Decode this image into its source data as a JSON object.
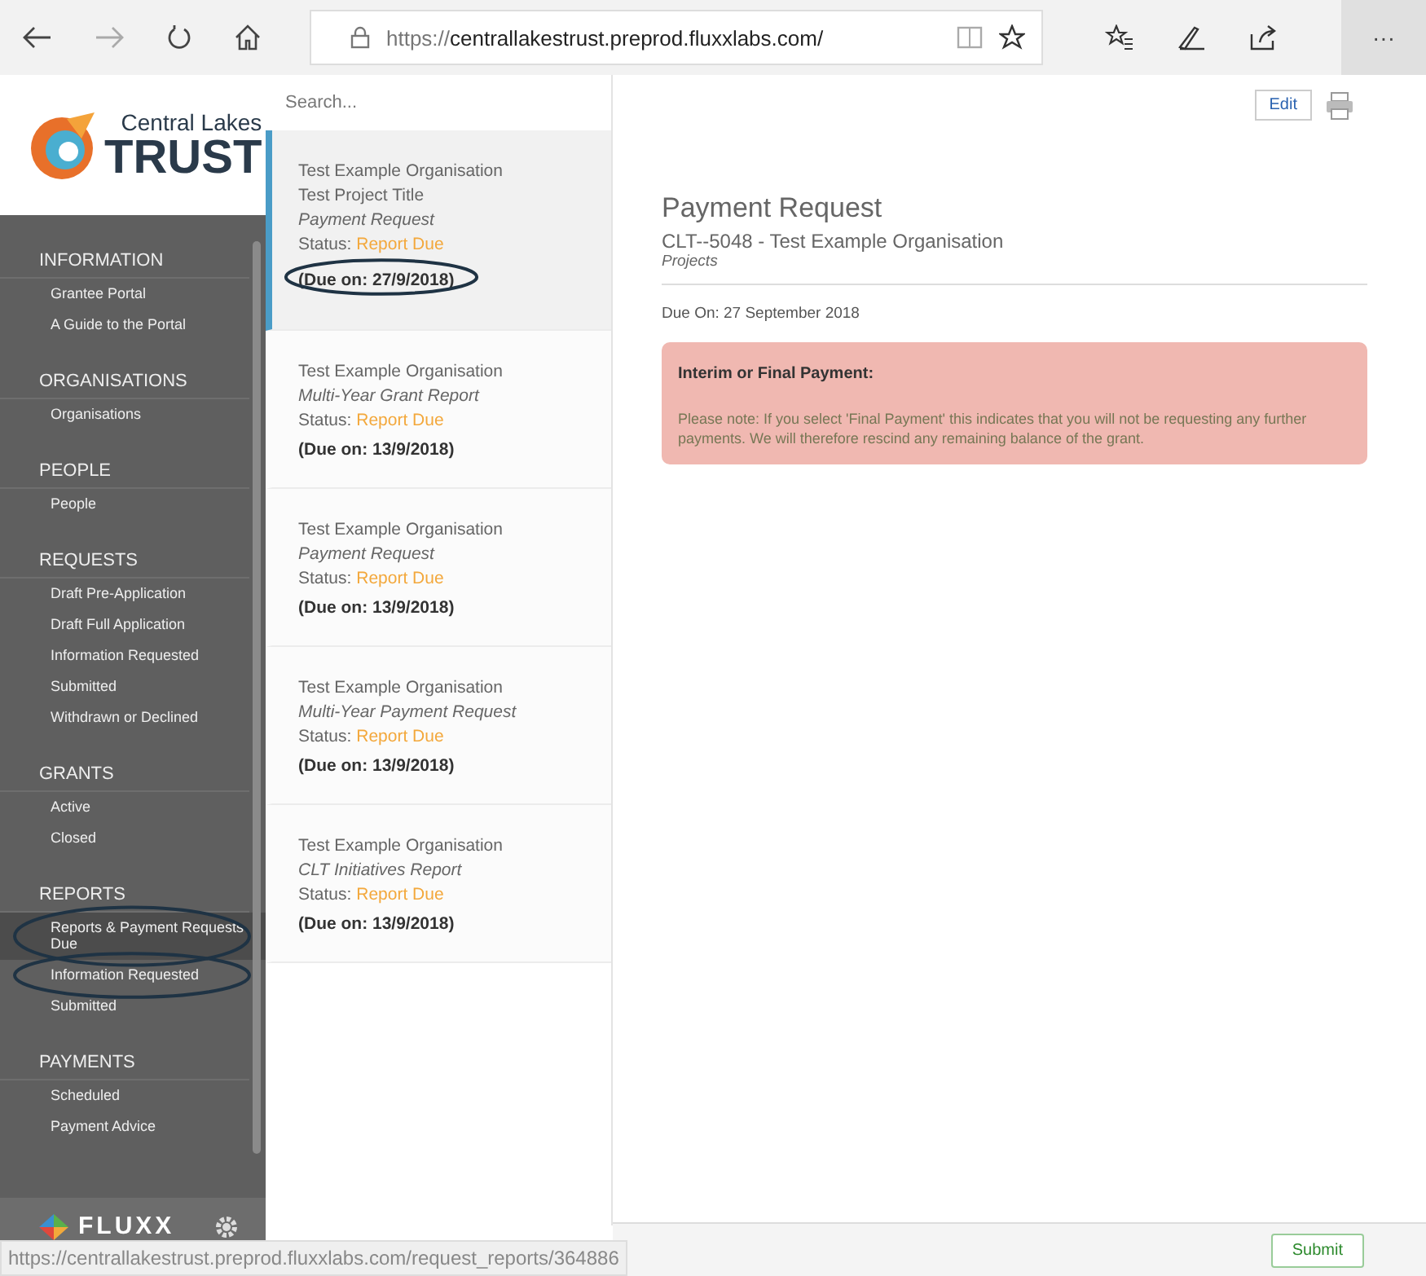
{
  "browser": {
    "url_prefix": "https://",
    "url_host": "centrallakestrust.preprod.fluxxlabs.com/",
    "more": "···"
  },
  "logo": {
    "line1": "Central Lakes",
    "line2": "TRUST"
  },
  "sidebar": {
    "sections": [
      {
        "title": "INFORMATION",
        "items": [
          {
            "label": "Grantee Portal",
            "selected": false,
            "circled": false
          },
          {
            "label": "A Guide to the Portal",
            "selected": false,
            "circled": false
          }
        ]
      },
      {
        "title": "ORGANISATIONS",
        "items": [
          {
            "label": "Organisations",
            "selected": false,
            "circled": false
          }
        ]
      },
      {
        "title": "PEOPLE",
        "items": [
          {
            "label": "People",
            "selected": false,
            "circled": false
          }
        ]
      },
      {
        "title": "REQUESTS",
        "items": [
          {
            "label": "Draft Pre-Application",
            "selected": false,
            "circled": false
          },
          {
            "label": "Draft Full Application",
            "selected": false,
            "circled": false
          },
          {
            "label": "Information Requested",
            "selected": false,
            "circled": false
          },
          {
            "label": "Submitted",
            "selected": false,
            "circled": false
          },
          {
            "label": "Withdrawn or Declined",
            "selected": false,
            "circled": false
          }
        ]
      },
      {
        "title": "GRANTS",
        "items": [
          {
            "label": "Active",
            "selected": false,
            "circled": false
          },
          {
            "label": "Closed",
            "selected": false,
            "circled": false
          }
        ]
      },
      {
        "title": "REPORTS",
        "items": [
          {
            "label": "Reports & Payment Requests Due",
            "selected": true,
            "circled": true
          },
          {
            "label": "Information Requested",
            "selected": false,
            "circled": true
          },
          {
            "label": "Submitted",
            "selected": false,
            "circled": false
          }
        ]
      },
      {
        "title": "PAYMENTS",
        "items": [
          {
            "label": "Scheduled",
            "selected": false,
            "circled": false
          },
          {
            "label": "Payment Advice",
            "selected": false,
            "circled": false
          }
        ]
      }
    ],
    "brand": "FLUXX"
  },
  "list": {
    "search": {
      "placeholder": "Search..."
    },
    "cards": [
      {
        "selected": true,
        "lines": [
          "Test Example Organisation",
          "Test Project Title"
        ],
        "type": "Payment Request",
        "status_label": "Status:",
        "status": "Report Due",
        "due": "(Due on: 27/9/2018)",
        "circled": true
      },
      {
        "selected": false,
        "lines": [
          "Test Example Organisation"
        ],
        "type": "Multi-Year Grant Report",
        "status_label": "Status:",
        "status": "Report Due",
        "due": "(Due on: 13/9/2018)",
        "circled": false
      },
      {
        "selected": false,
        "lines": [
          "Test Example Organisation"
        ],
        "type": "Payment Request",
        "status_label": "Status:",
        "status": "Report Due",
        "due": "(Due on: 13/9/2018)",
        "circled": false
      },
      {
        "selected": false,
        "lines": [
          "Test Example Organisation"
        ],
        "type": "Multi-Year Payment Request",
        "status_label": "Status:",
        "status": "Report Due",
        "due": "(Due on: 13/9/2018)",
        "circled": false
      },
      {
        "selected": false,
        "lines": [
          "Test Example Organisation"
        ],
        "type": "CLT Initiatives Report",
        "status_label": "Status:",
        "status": "Report Due",
        "due": "(Due on: 13/9/2018)",
        "circled": false
      }
    ]
  },
  "detail": {
    "edit_button": "Edit",
    "title": "Payment Request",
    "subtitle": "CLT--5048 - Test Example Organisation",
    "category": "Projects",
    "due": "Due On: 27 September 2018",
    "alert": {
      "title": "Interim or Final Payment:",
      "body": "Please note: If you select 'Final Payment' this indicates that you will not be requesting any further payments. We will therefore rescind any remaining balance of the grant."
    },
    "submit_button": "Submit"
  },
  "status_bar": {
    "url": "https://centrallakestrust.preprod.fluxxlabs.com/request_reports/364886"
  }
}
